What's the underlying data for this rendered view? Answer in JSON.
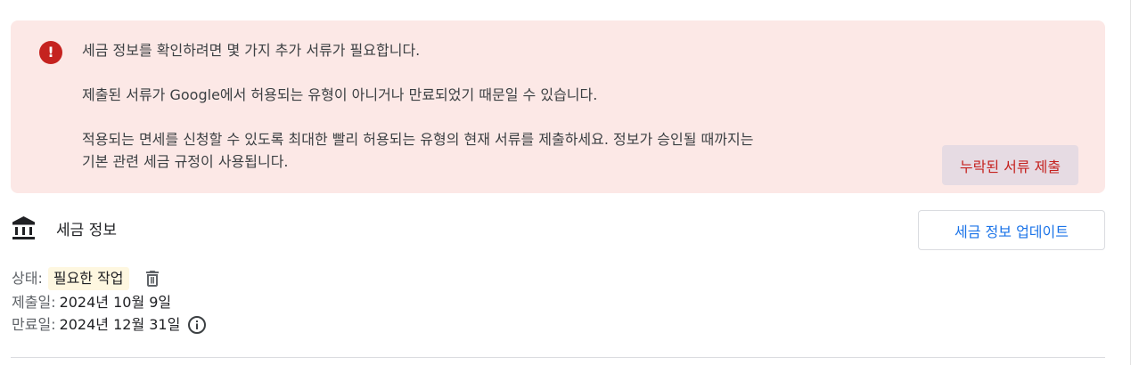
{
  "alert": {
    "icon": "error-icon",
    "icon_glyph": "!",
    "line_1": "세금 정보를 확인하려면 몇 가지 추가 서류가 필요합니다.",
    "line_2": "제출된 서류가 Google에서 허용되는 유형이 아니거나 만료되었기 때문일 수 있습니다.",
    "line_3": "적용되는 면세를 신청할 수 있도록 최대한 빨리 허용되는 유형의 현재 서류를 제출하세요. 정보가 승인될 때까지는",
    "line_4": "기본 관련 세금 규정이 사용됩니다.",
    "button_label": "누락된 서류 제출",
    "accent_color": "#c5221f",
    "background_color": "#fce8e6"
  },
  "tax_info": {
    "icon": "bank-icon",
    "title": "세금 정보",
    "update_button_label": "세금 정보 업데이트",
    "status_label": "상태:",
    "status_value": "필요한 작업",
    "submitted_label": "제출일:",
    "submitted_value": "2024년 10월 9일",
    "expires_label": "만료일:",
    "expires_value": "2024년 12월 31일"
  },
  "colors": {
    "link_blue": "#1a73e8",
    "status_badge_bg": "#fef7e0"
  }
}
